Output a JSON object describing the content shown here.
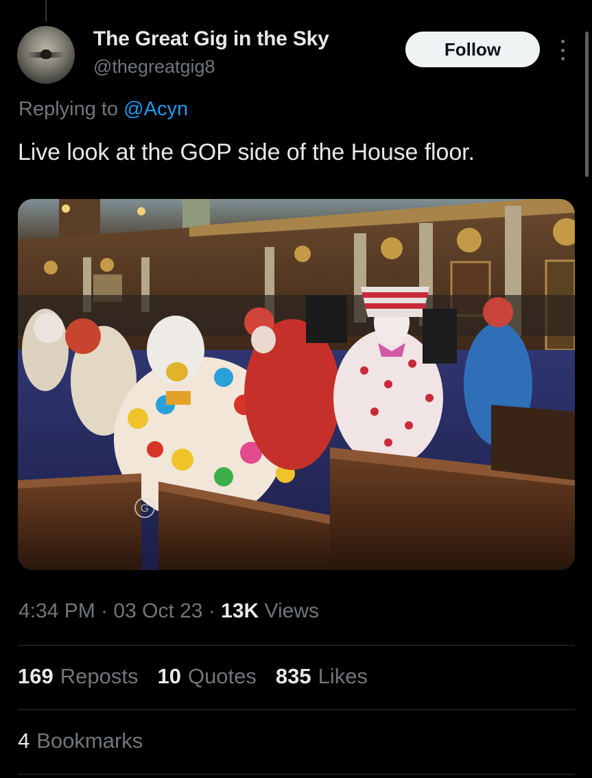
{
  "author": {
    "display_name": "The Great Gig in the Sky",
    "handle": "@thegreatgig8"
  },
  "follow_label": "Follow",
  "reply_context": {
    "prefix": "Replying to",
    "mention": "@Acyn"
  },
  "tweet_text": "Live look at the GOP side of the House floor.",
  "media": {
    "watermark_label": "G"
  },
  "meta": {
    "time": "4:34 PM",
    "sep1": " · ",
    "date": "03 Oct 23",
    "sep2": " · ",
    "views_count": "13K",
    "views_label": "Views"
  },
  "stats": [
    {
      "count": "169",
      "label": "Reposts"
    },
    {
      "count": "10",
      "label": "Quotes"
    },
    {
      "count": "835",
      "label": "Likes"
    }
  ],
  "bookmarks": {
    "count": "4",
    "label": "Bookmarks"
  },
  "colors": {
    "background": "#000000",
    "text": "#e7e9ea",
    "secondary": "#71767b",
    "link": "#1d9bf0",
    "follow_bg": "#eff3f4",
    "divider": "#2f3336"
  }
}
